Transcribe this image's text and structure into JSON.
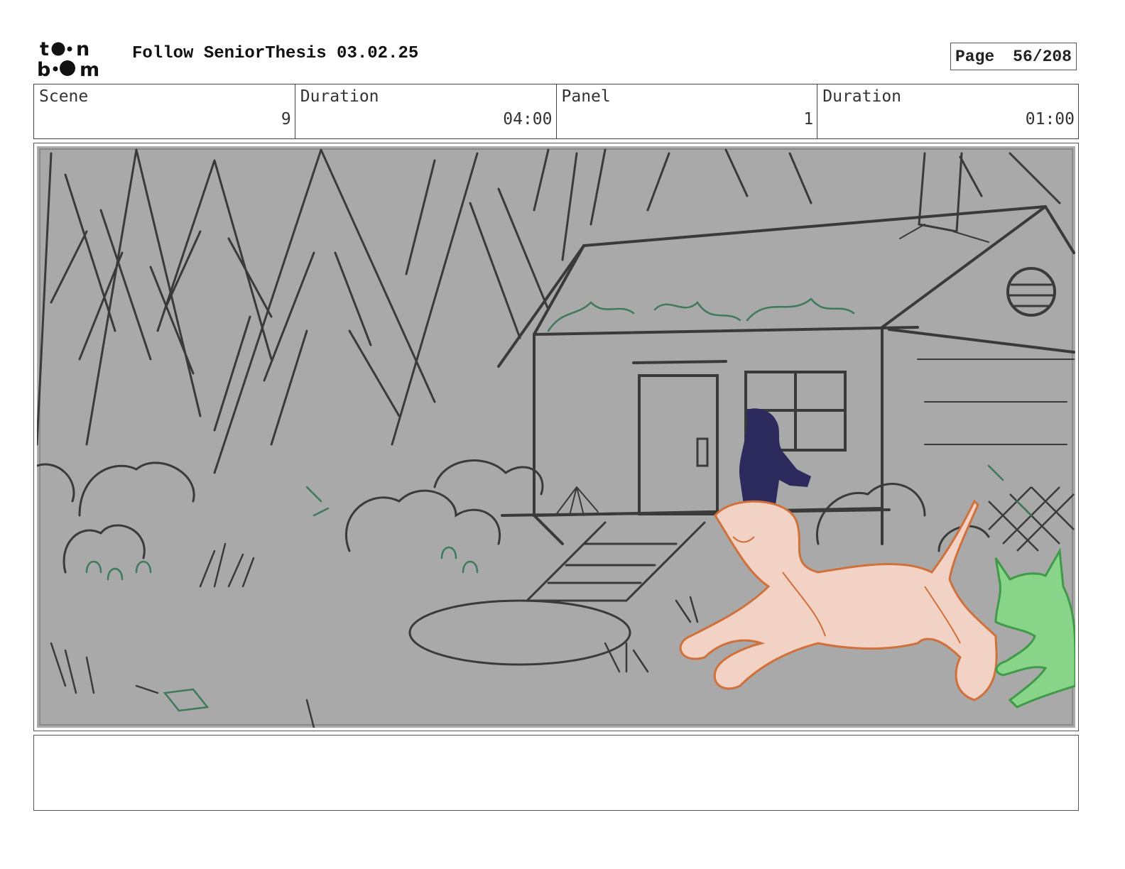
{
  "header": {
    "logo_text": "toon boom",
    "title": "Follow SeniorThesis 03.02.25",
    "page_label": "Page",
    "page_value": "56/208"
  },
  "info": {
    "scene_label": "Scene",
    "scene_value": "9",
    "scene_duration_label": "Duration",
    "scene_duration_value": "04:00",
    "panel_label": "Panel",
    "panel_value": "1",
    "panel_duration_label": "Duration",
    "panel_duration_value": "01:00"
  },
  "colors": {
    "background_fill": "#a9a9a9",
    "sketch_line": "#3a3a3a",
    "foliage": "#3f7a5a",
    "figure": "#2d2a5e",
    "dog_fill": "#f2d2c4",
    "dog_line": "#d0703a",
    "fox_fill": "#88d488",
    "fox_line": "#3f9a4a"
  },
  "notes": {
    "text": ""
  }
}
